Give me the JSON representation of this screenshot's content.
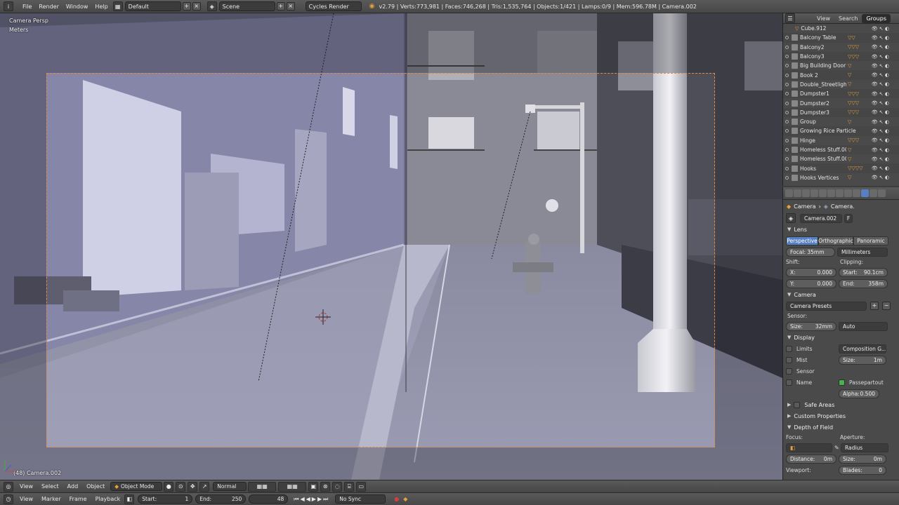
{
  "top_menu": {
    "items": [
      "File",
      "Render",
      "Window",
      "Help"
    ],
    "layout": "Default",
    "scene": "Scene",
    "engine": "Cycles Render",
    "stats": "v2.79 | Verts:773,981 | Faces:746,268 | Tris:1,535,764 | Objects:1/421 | Lamps:0/9 | Mem:596.78M | Camera.002"
  },
  "viewport": {
    "view_name": "Camera Persp",
    "units": "Meters",
    "object_label": "(48) Camera.002"
  },
  "outliner": {
    "tabs": [
      "View",
      "Search",
      "Groups"
    ],
    "rows": [
      "Cube.912",
      "Balcony Table",
      "Balcony2",
      "Balcony3",
      "Big Building Door",
      "Book 2",
      "Double_Streetlight",
      "Dumpster1",
      "Dumpster2",
      "Dumpster3",
      "Group",
      "Growing Rice Particles",
      "Hinge",
      "Homeless Stuff.001",
      "Homeless Stuff.002",
      "Hooks",
      "Hooks Vertices"
    ]
  },
  "properties": {
    "breadcrumb": [
      "Camera",
      "Camera."
    ],
    "datablock": "Camera.002",
    "datablock_flag": "F",
    "lens": {
      "title": "Lens",
      "types": [
        "Perspective",
        "Orthographic",
        "Panoramic"
      ],
      "focal": "Focal: 35mm",
      "lens_unit": "Millimeters",
      "shift_label": "Shift:",
      "shift_x": "X:",
      "shift_x_val": "0.000",
      "shift_y": "Y:",
      "shift_y_val": "0.000",
      "clipping_label": "Clipping:",
      "clip_start": "Start:",
      "clip_start_val": "90.1cm",
      "clip_end": "End:",
      "clip_end_val": "358m"
    },
    "camera": {
      "title": "Camera",
      "presets": "Camera Presets",
      "sensor_label": "Sensor:",
      "size_label": "Size:",
      "size_val": "32mm",
      "fit": "Auto"
    },
    "display": {
      "title": "Display",
      "limits": "Limits",
      "mist": "Mist",
      "sensor": "Sensor",
      "name": "Name",
      "composition": "Composition G...",
      "size_label": "Size:",
      "size_val": "1m",
      "passepartout": "Passepartout",
      "alpha_label": "Alpha:",
      "alpha_val": "0.500"
    },
    "safe_areas": "Safe Areas",
    "custom_properties": "Custom Properties",
    "dof": {
      "title": "Depth of Field",
      "focus_label": "Focus:",
      "aperture_label": "Aperture:",
      "aperture_type": "Radius",
      "distance_label": "Distance:",
      "distance_val": "0m",
      "size_label": "Size:",
      "size_val": "0m",
      "viewport_label": "Viewport:",
      "blades_label": "Blades:",
      "blades_val": "0"
    }
  },
  "view3d_header": {
    "items": [
      "View",
      "Select",
      "Add",
      "Object"
    ],
    "mode": "Object Mode",
    "pivot": "Normal"
  },
  "timeline": {
    "items": [
      "View",
      "Marker",
      "Frame",
      "Playback"
    ],
    "start_label": "Start:",
    "start_val": "1",
    "end_label": "End:",
    "end_val": "250",
    "current": "48",
    "sync": "No Sync"
  },
  "colors": {
    "accent_blue": "#5680c2",
    "frame_orange": "#e8893f",
    "object_triangle": "#e6a23c"
  }
}
